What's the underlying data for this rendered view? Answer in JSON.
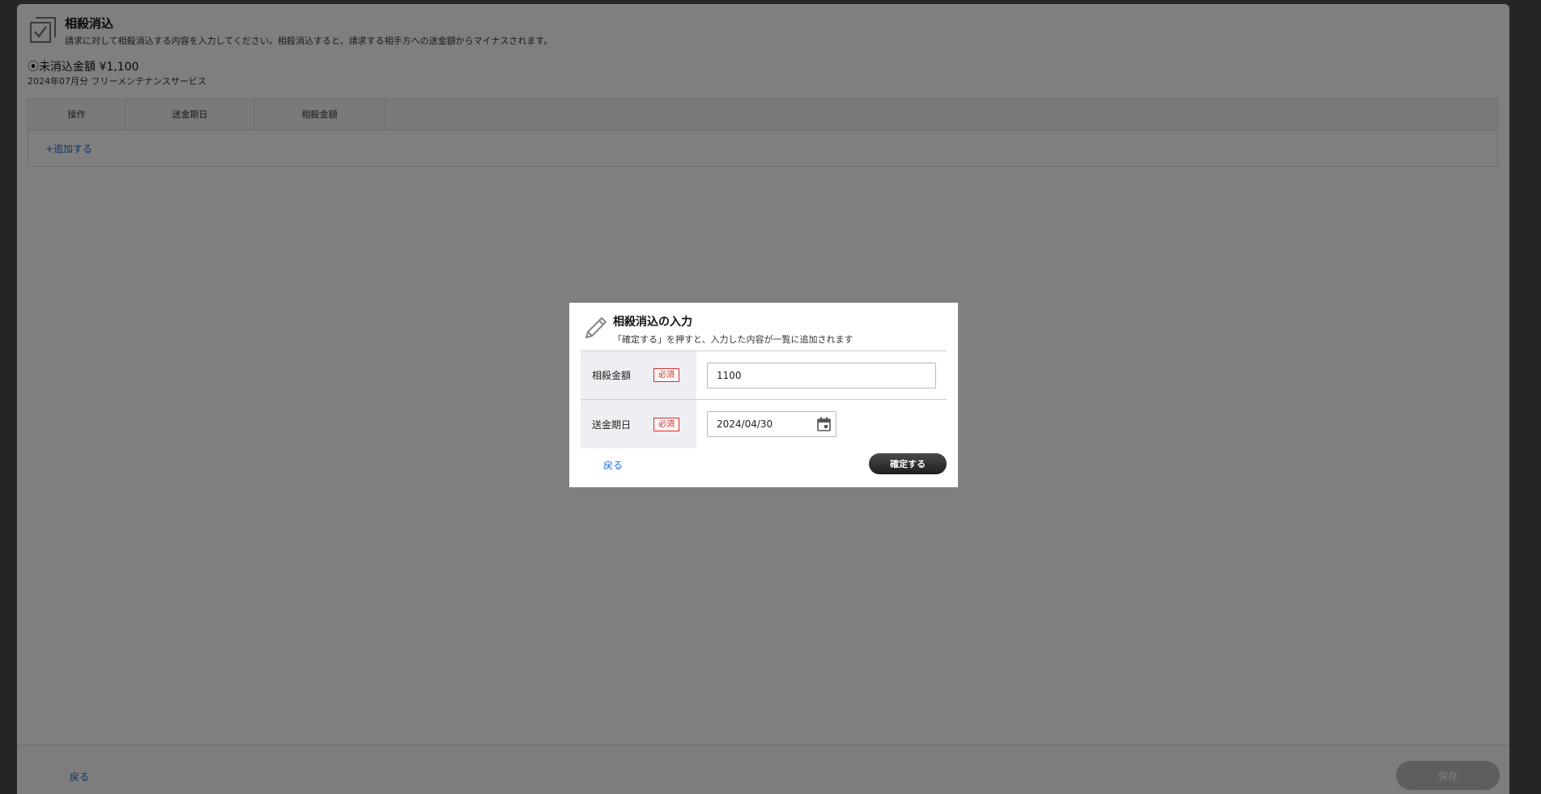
{
  "panel": {
    "title": "相殺消込",
    "description": "請求に対して相殺消込する内容を入力してください。相殺消込すると、請求する相手方への送金額からマイナスされます。",
    "unpaid_amount": "⦿未消込金額 ¥1,100",
    "item_desc": "2024年07月分 フリーメンテナンスサービス",
    "table": {
      "columns": [
        "操作",
        "送金期日",
        "相殺金額"
      ],
      "add_link": "+追加する"
    },
    "footer": {
      "back_label": "戻る",
      "save_label": "保存"
    }
  },
  "dialog": {
    "title": "相殺消込の入力",
    "description": "「確定する」を押すと、入力した内容が一覧に追加されます",
    "fields": [
      {
        "label": "相殺金額",
        "required_badge": "必須",
        "value": "1100"
      },
      {
        "label": "送金期日",
        "required_badge": "必須",
        "value": "2024/04/30"
      }
    ],
    "back_label": "戻る",
    "confirm_label": "確定する"
  },
  "icons": {
    "panel_icon": "stacked-checkbox-icon",
    "dialog_icon": "pencil-icon",
    "date_icon": "calendar-icon"
  },
  "colors": {
    "link": "#1a6fd1",
    "required": "#d0312d",
    "confirm_button": "#2a2a2a",
    "save_button_disabled": "#bdbdbd",
    "label_cell_bg": "#efeef3"
  }
}
